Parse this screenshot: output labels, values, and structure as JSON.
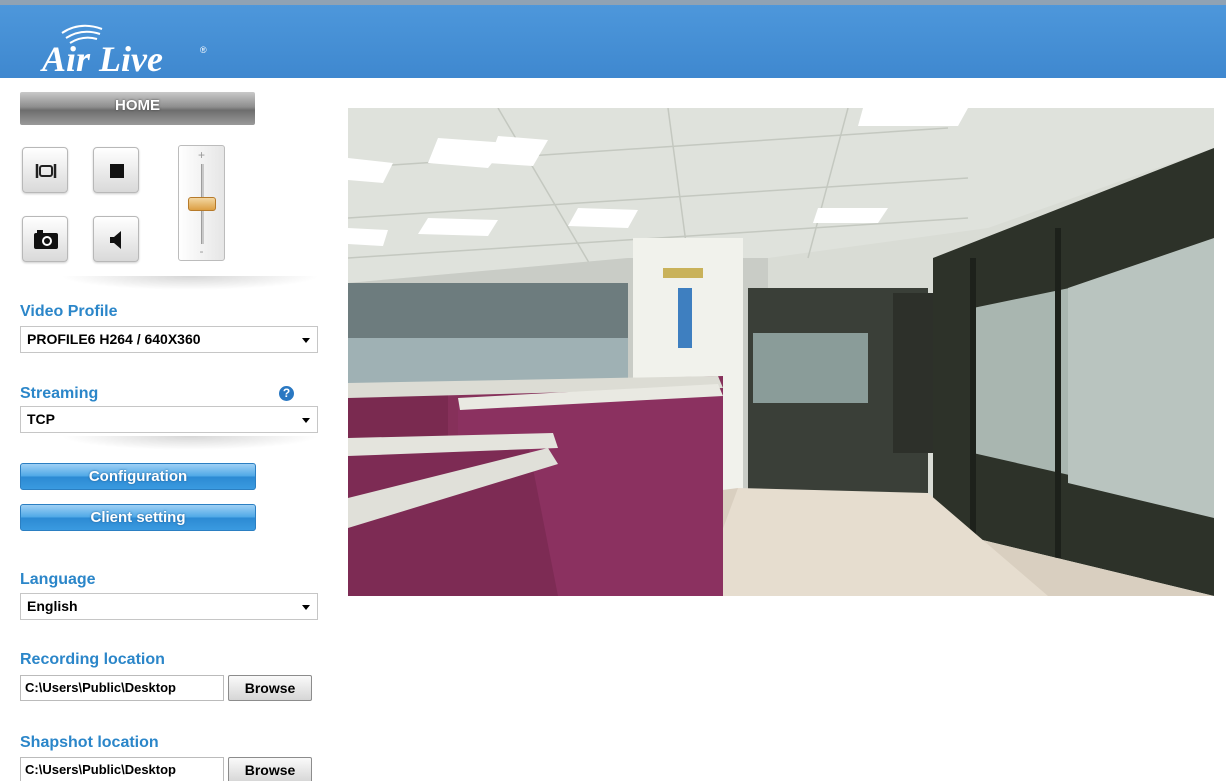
{
  "header": {
    "logo_text": "Air Live",
    "logo_mark": "®",
    "bg_color": "#4a94d9"
  },
  "sidebar": {
    "home_label": "HOME",
    "controls": {
      "fullscreen_icon": "fullscreen-icon",
      "stop_icon": "stop-icon",
      "snapshot_icon": "camera-icon",
      "audio_icon": "speaker-icon",
      "zoom_plus": "+",
      "zoom_minus": "-",
      "zoom_level": 0.5
    },
    "video_profile": {
      "label": "Video Profile",
      "value": "PROFILE6 H264 / 640X360"
    },
    "streaming": {
      "label": "Streaming",
      "value": "TCP",
      "help": "?"
    },
    "configuration_label": "Configuration",
    "client_setting_label": "Client setting",
    "language": {
      "label": "Language",
      "value": "English"
    },
    "recording": {
      "label": "Recording location",
      "path": "C:\\Users\\Public\\Desktop",
      "browse": "Browse"
    },
    "snapshot": {
      "label": "Shapshot location",
      "path": "C:\\Users\\Public\\Desktop",
      "browse": "Browse"
    }
  },
  "colors": {
    "accent": "#2b86c9",
    "button_blue": "#3a9ae0",
    "slider_thumb": "#dc9f43"
  }
}
